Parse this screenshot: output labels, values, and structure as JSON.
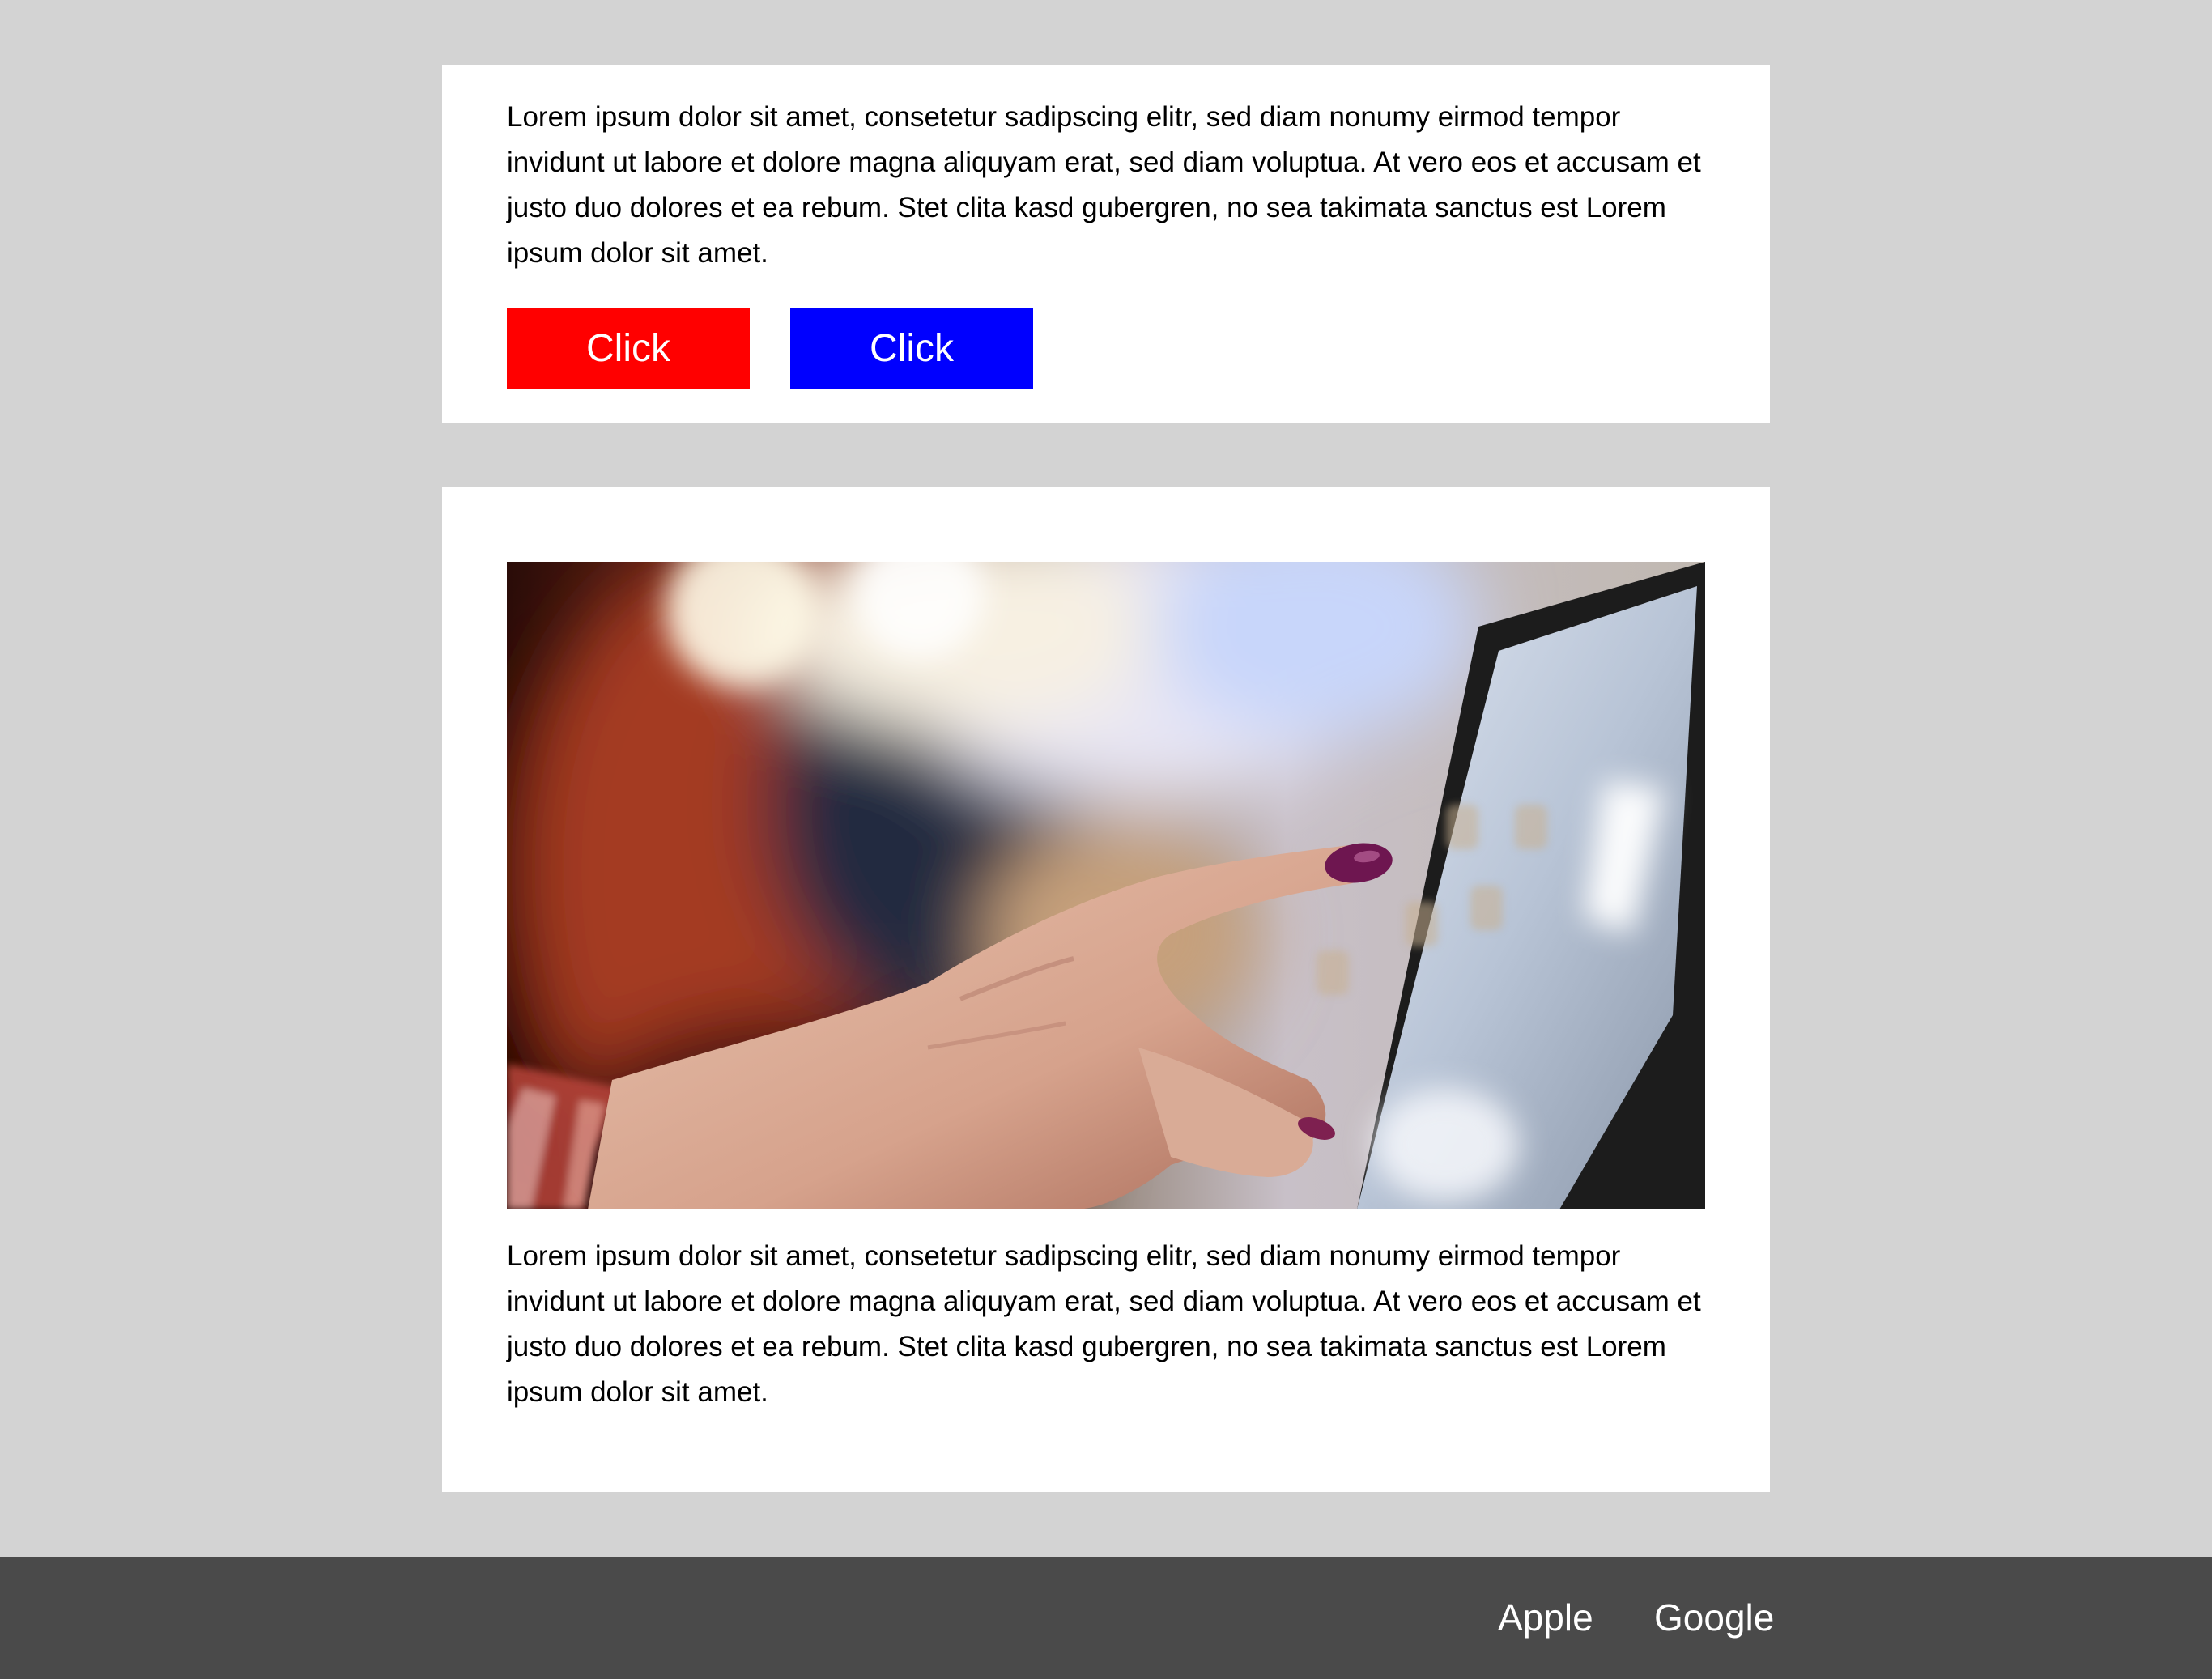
{
  "colors": {
    "page_background": "#d3d3d3",
    "card_background": "#ffffff",
    "button_red": "#ff0000",
    "button_blue": "#0000ff",
    "footer_background": "#4a4a4a",
    "footer_text": "#ffffff"
  },
  "card1": {
    "paragraph": "Lorem ipsum dolor sit amet, consetetur sadipscing elitr, sed diam nonumy eirmod tempor invidunt ut labore et dolore magna aliquyam erat, sed diam voluptua. At vero eos et accusam et justo duo dolores et ea rebum. Stet clita kasd gubergren, no sea takimata sanctus est Lorem ipsum dolor sit amet.",
    "buttons": [
      {
        "label": "Click",
        "color": "#ff0000"
      },
      {
        "label": "Click",
        "color": "#0000ff"
      }
    ]
  },
  "card2": {
    "paragraph": "Lorem ipsum dolor sit amet, consetetur sadipscing elitr, sed diam nonumy eirmod tempor invidunt ut labore et dolore magna aliquyam erat, sed diam voluptua. At vero eos et accusam et justo duo dolores et ea rebum. Stet clita kasd gubergren, no sea takimata sanctus est Lorem ipsum dolor sit amet."
  },
  "footer": {
    "links": [
      {
        "label": "Apple"
      },
      {
        "label": "Google"
      }
    ]
  }
}
